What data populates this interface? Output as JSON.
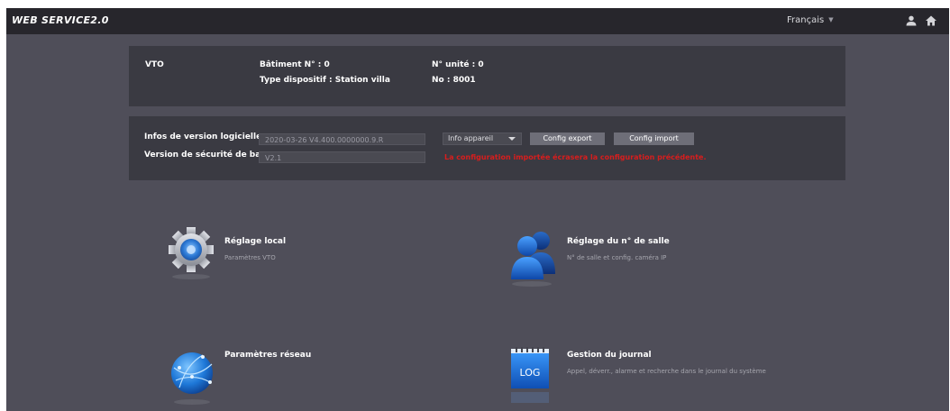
{
  "header": {
    "brand": "WEB SERVICE2.0",
    "language": "Français",
    "icons": [
      "user-icon",
      "home-icon"
    ]
  },
  "device_panel": {
    "title": "VTO",
    "building": "Bâtiment N° : 0",
    "unit": "N° unité : 0",
    "type": "Type dispositif : Station villa",
    "number": "No : 8001"
  },
  "version_panel": {
    "software_label": "Infos de version logicielle",
    "software_value": "2020-03-26 V4.400.0000000.9.R",
    "security_label": "Version de sécurité de base",
    "security_value": "V2.1",
    "select_value": "Info appareil",
    "export_button": "Config export",
    "import_button": "Config import",
    "warning": "La configuration importée écrasera la configuration précédente.",
    "warning_color": "#d91d1d"
  },
  "tiles": [
    {
      "title": "Réglage local",
      "desc": "Paramètres VTO",
      "icon": "gear-icon"
    },
    {
      "title": "Réglage du n° de salle",
      "desc": "N° de salle et config. caméra IP",
      "icon": "users-icon"
    },
    {
      "title": "Paramètres réseau",
      "desc": "",
      "icon": "globe-icon"
    },
    {
      "title": "Gestion du journal",
      "desc": "Appel, déverr., alarme et recherche dans le journal du système",
      "icon": "log-icon",
      "icon_text": "LOG"
    }
  ]
}
